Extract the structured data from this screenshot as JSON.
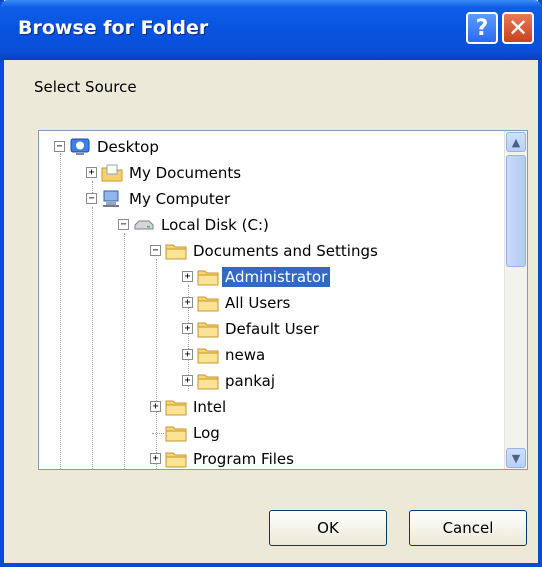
{
  "window": {
    "title": "Browse for Folder",
    "help_glyph": "?",
    "close_glyph": "✕"
  },
  "prompt": "Select Source",
  "tree": {
    "nodes": [
      {
        "label": "Desktop",
        "icon": "desktop-icon",
        "expander": "−"
      },
      {
        "label": "My Documents",
        "icon": "my-documents-icon",
        "expander": "+"
      },
      {
        "label": "My Computer",
        "icon": "my-computer-icon",
        "expander": "−"
      },
      {
        "label": "Local Disk (C:)",
        "icon": "drive-icon",
        "expander": "−"
      },
      {
        "label": "Documents and Settings",
        "icon": "folder-icon",
        "expander": "−"
      },
      {
        "label": "Administrator",
        "icon": "folder-icon",
        "expander": "+",
        "selected": true
      },
      {
        "label": "All Users",
        "icon": "folder-icon",
        "expander": "+"
      },
      {
        "label": "Default User",
        "icon": "folder-icon",
        "expander": "+"
      },
      {
        "label": "newa",
        "icon": "folder-icon",
        "expander": "+"
      },
      {
        "label": "pankaj",
        "icon": "folder-icon",
        "expander": "+"
      },
      {
        "label": "Intel",
        "icon": "folder-icon",
        "expander": "+"
      },
      {
        "label": "Log",
        "icon": "folder-icon",
        "expander": ""
      },
      {
        "label": "Program Files",
        "icon": "folder-icon",
        "expander": "+"
      }
    ]
  },
  "buttons": {
    "ok": "OK",
    "cancel": "Cancel"
  },
  "colors": {
    "titlebar": "#0a4fd7",
    "selection": "#316ac5",
    "dialog_bg": "#ece9d8"
  }
}
